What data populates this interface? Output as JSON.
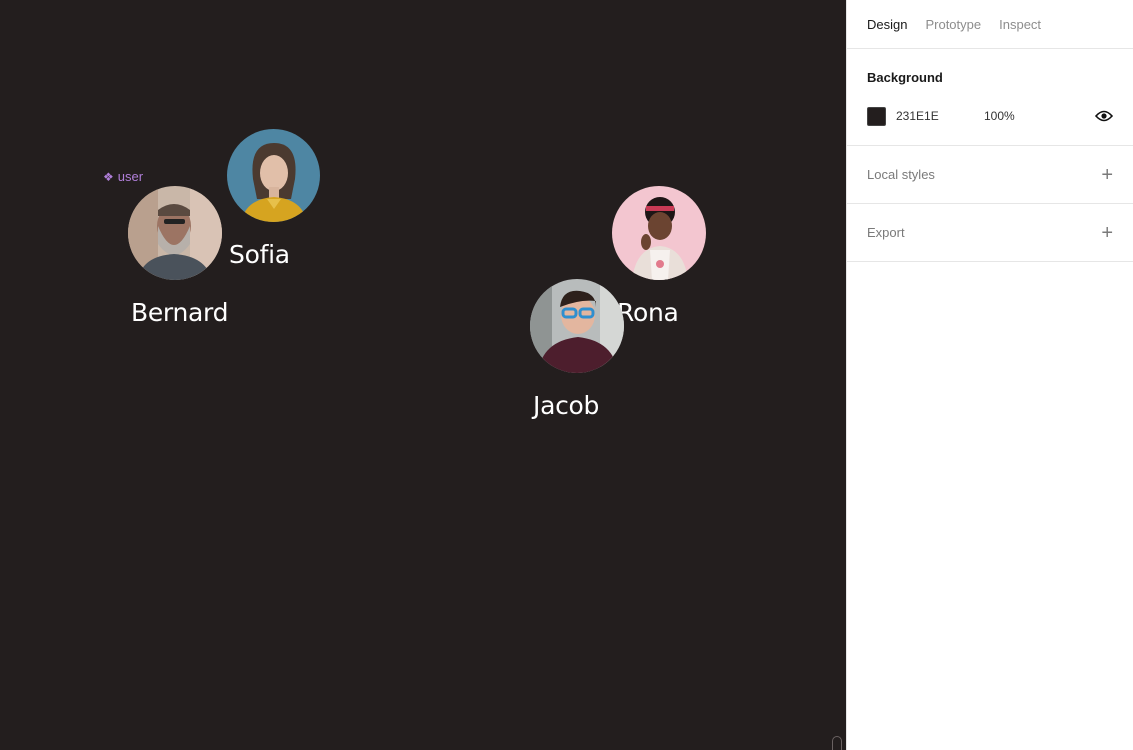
{
  "canvas": {
    "background": "#231E1E",
    "component_label": "user",
    "users": [
      {
        "name": "Bernard",
        "photo": "avatar-bernard"
      },
      {
        "name": "Sofia",
        "photo": "avatar-sofia"
      },
      {
        "name": "Rona",
        "photo": "avatar-rona"
      },
      {
        "name": "Jacob",
        "photo": "avatar-jacob"
      }
    ]
  },
  "panel": {
    "tabs": [
      {
        "label": "Design",
        "active": true
      },
      {
        "label": "Prototype",
        "active": false
      },
      {
        "label": "Inspect",
        "active": false
      }
    ],
    "background": {
      "title": "Background",
      "hex": "231E1E",
      "opacity": "100%",
      "visibility_icon": "eye-icon"
    },
    "local_styles": {
      "title": "Local styles",
      "icon": "plus-icon"
    },
    "export": {
      "title": "Export",
      "icon": "plus-icon"
    }
  },
  "colors": {
    "canvas_bg": "#231E1E",
    "component_accent": "#b07fd9",
    "panel_bg": "#ffffff"
  }
}
